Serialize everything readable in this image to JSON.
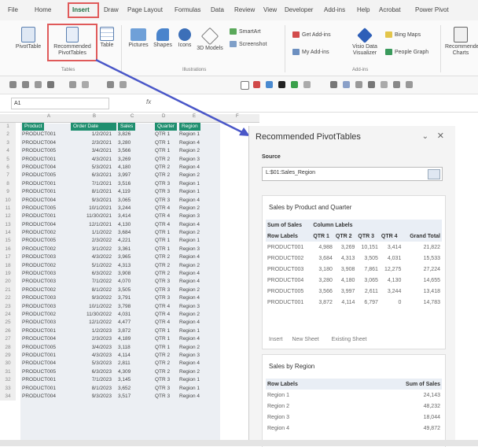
{
  "ribbon": {
    "tabs": [
      "File",
      "Home",
      "Insert",
      "Draw",
      "Page Layout",
      "Formulas",
      "Data",
      "Review",
      "View",
      "Developer",
      "Add-ins",
      "Help",
      "Acrobat",
      "Power Pivot"
    ],
    "active_tab": "Insert",
    "tables_group": {
      "label": "Tables",
      "pivottable": "PivotTable",
      "recommended": "Recommended PivotTables",
      "table": "Table"
    },
    "illustrations_group": {
      "label": "Illustrations",
      "pictures": "Pictures",
      "shapes": "Shapes",
      "icons": "Icons",
      "models": "3D Models"
    },
    "smartart": "SmartArt",
    "screenshot": "Screenshot",
    "addins_group": {
      "label": "Add-ins",
      "get": "Get Add-ins",
      "my": "My Add-ins",
      "visio": "Visio Data Visualizer",
      "bing": "Bing Maps",
      "people": "People Graph"
    },
    "recommended_charts": "Recommended Charts"
  },
  "formula_bar": {
    "name_box": "A1",
    "fx": "fx"
  },
  "grid": {
    "columns": [
      "A",
      "B",
      "C",
      "D",
      "E",
      "F"
    ],
    "header": [
      "Product",
      "Order Date",
      "Sales",
      "Quarter",
      "Region"
    ],
    "rows": [
      [
        "PRODUCT001",
        "1/2/2021",
        "3,826",
        "QTR 1",
        "Region 1"
      ],
      [
        "PRODUCT004",
        "2/3/2021",
        "3,280",
        "QTR 1",
        "Region 4"
      ],
      [
        "PRODUCT005",
        "3/4/2021",
        "3,566",
        "QTR 1",
        "Region 2"
      ],
      [
        "PRODUCT001",
        "4/3/2021",
        "3,269",
        "QTR 2",
        "Region 3"
      ],
      [
        "PRODUCT004",
        "5/3/2021",
        "4,180",
        "QTR 2",
        "Region 4"
      ],
      [
        "PRODUCT005",
        "6/3/2021",
        "3,997",
        "QTR 2",
        "Region 2"
      ],
      [
        "PRODUCT001",
        "7/1/2021",
        "3,516",
        "QTR 3",
        "Region 1"
      ],
      [
        "PRODUCT001",
        "8/1/2021",
        "4,119",
        "QTR 3",
        "Region 1"
      ],
      [
        "PRODUCT004",
        "9/3/2021",
        "3,065",
        "QTR 3",
        "Region 4"
      ],
      [
        "PRODUCT005",
        "10/1/2021",
        "3,244",
        "QTR 4",
        "Region 2"
      ],
      [
        "PRODUCT001",
        "11/30/2021",
        "3,414",
        "QTR 4",
        "Region 3"
      ],
      [
        "PRODUCT004",
        "12/1/2021",
        "4,130",
        "QTR 4",
        "Region 4"
      ],
      [
        "PRODUCT002",
        "1/1/2022",
        "3,684",
        "QTR 1",
        "Region 2"
      ],
      [
        "PRODUCT005",
        "2/3/2022",
        "4,221",
        "QTR 1",
        "Region 1"
      ],
      [
        "PRODUCT002",
        "3/1/2022",
        "3,361",
        "QTR 1",
        "Region 3"
      ],
      [
        "PRODUCT003",
        "4/3/2022",
        "3,965",
        "QTR 2",
        "Region 4"
      ],
      [
        "PRODUCT002",
        "5/1/2022",
        "4,313",
        "QTR 2",
        "Region 2"
      ],
      [
        "PRODUCT003",
        "6/3/2022",
        "3,908",
        "QTR 2",
        "Region 4"
      ],
      [
        "PRODUCT003",
        "7/1/2022",
        "4,070",
        "QTR 3",
        "Region 4"
      ],
      [
        "PRODUCT002",
        "8/1/2022",
        "3,505",
        "QTR 3",
        "Region 2"
      ],
      [
        "PRODUCT003",
        "9/3/2022",
        "3,791",
        "QTR 3",
        "Region 4"
      ],
      [
        "PRODUCT003",
        "10/1/2022",
        "3,798",
        "QTR 4",
        "Region 3"
      ],
      [
        "PRODUCT002",
        "11/30/2022",
        "4,031",
        "QTR 4",
        "Region 2"
      ],
      [
        "PRODUCT003",
        "12/1/2022",
        "4,477",
        "QTR 4",
        "Region 4"
      ],
      [
        "PRODUCT001",
        "1/2/2023",
        "3,872",
        "QTR 1",
        "Region 1"
      ],
      [
        "PRODUCT004",
        "2/3/2023",
        "4,189",
        "QTR 1",
        "Region 4"
      ],
      [
        "PRODUCT005",
        "3/4/2023",
        "3,118",
        "QTR 1",
        "Region 2"
      ],
      [
        "PRODUCT001",
        "4/3/2023",
        "4,114",
        "QTR 2",
        "Region 3"
      ],
      [
        "PRODUCT004",
        "5/3/2023",
        "2,811",
        "QTR 2",
        "Region 4"
      ],
      [
        "PRODUCT005",
        "6/3/2023",
        "4,309",
        "QTR 2",
        "Region 2"
      ],
      [
        "PRODUCT001",
        "7/1/2023",
        "3,145",
        "QTR 3",
        "Region 1"
      ],
      [
        "PRODUCT001",
        "8/1/2023",
        "3,652",
        "QTR 3",
        "Region 1"
      ],
      [
        "PRODUCT004",
        "9/3/2023",
        "3,517",
        "QTR 3",
        "Region 4"
      ]
    ]
  },
  "pane": {
    "title": "Recommended PivotTables",
    "source_label": "Source",
    "source_value": "L:$01:Sales_Region",
    "card1": {
      "title": "Sales by Product and Quarter",
      "value_label": "Sum of Sales",
      "col_labels": "Column Labels",
      "row_labels": "Row Labels",
      "quarters": [
        "QTR 1",
        "QTR 2",
        "QTR 3",
        "QTR 4",
        "Grand Total"
      ],
      "rows": [
        [
          "PRODUCT001",
          "4,988",
          "3,269",
          "10,151",
          "3,414",
          "21,822"
        ],
        [
          "PRODUCT002",
          "3,684",
          "4,313",
          "3,505",
          "4,031",
          "15,533"
        ],
        [
          "PRODUCT003",
          "3,180",
          "3,908",
          "7,861",
          "12,275",
          "27,224"
        ],
        [
          "PRODUCT004",
          "3,280",
          "4,180",
          "3,065",
          "4,130",
          "14,655"
        ],
        [
          "PRODUCT005",
          "3,566",
          "3,997",
          "2,611",
          "3,244",
          "13,418"
        ],
        [
          "PRODUCT001",
          "3,872",
          "4,114",
          "6,797",
          "0",
          "14,783"
        ]
      ],
      "insert_label": "Insert",
      "new_sheet": "New Sheet",
      "existing_sheet": "Existing Sheet"
    },
    "card2": {
      "title": "Sales by Region",
      "row_labels": "Row Labels",
      "value_label": "Sum of Sales",
      "rows": [
        [
          "Region 1",
          "24,143"
        ],
        [
          "Region 2",
          "48,232"
        ],
        [
          "Region 3",
          "18,044"
        ],
        [
          "Region 4",
          "49,872"
        ]
      ]
    }
  },
  "colors": {
    "accent": "#1f8f6f",
    "highlight": "#e05a5a",
    "arrow": "#4a57c8"
  }
}
